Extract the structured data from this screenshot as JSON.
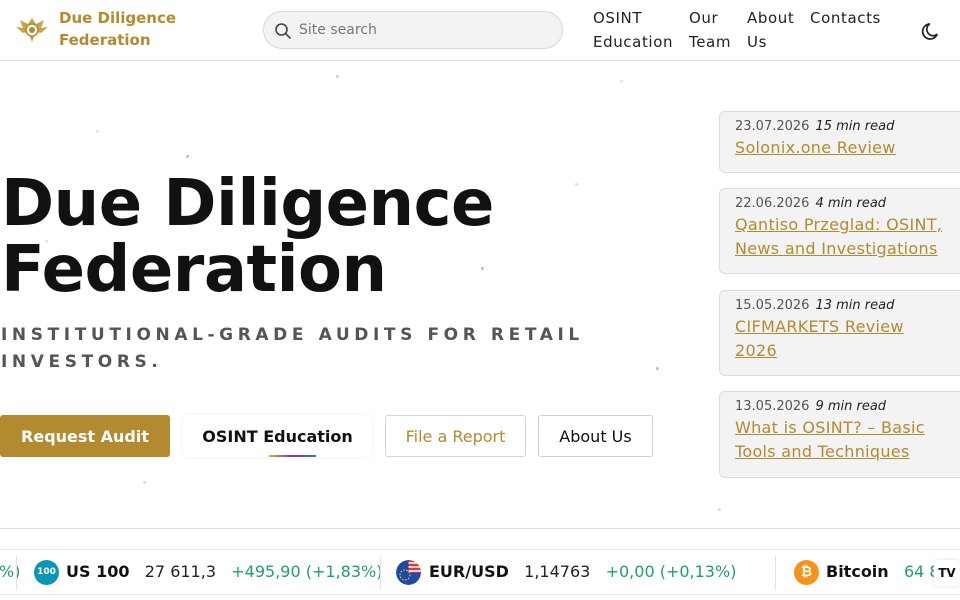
{
  "header": {
    "brand_line1": "Due Diligence",
    "brand_line2": "Federation",
    "search_placeholder": "Site search",
    "nav": [
      {
        "line1": "OSINT",
        "line2": "Education"
      },
      {
        "line1": "Our",
        "line2": "Team"
      },
      {
        "line1": "About",
        "line2": "Us"
      },
      {
        "line1": "Contacts",
        "line2": ""
      }
    ]
  },
  "hero": {
    "title_line1": "Due Diligence",
    "title_line2": "Federation",
    "subtitle_line1": "INSTITUTIONAL-GRADE AUDITS FOR RETAIL",
    "subtitle_line2": "INVESTORS.",
    "buttons": {
      "request_audit": "Request Audit",
      "osint_education": "OSINT Education",
      "file_report": "File a Report",
      "about_us": "About Us"
    }
  },
  "articles": [
    {
      "date": "23.07.2026",
      "read_time": "15 min read",
      "title": "Solonix.one Review"
    },
    {
      "date": "22.06.2026",
      "read_time": "4 min read",
      "title": "Qantiso Przeglad: OSINT, News and Investigations"
    },
    {
      "date": "15.05.2026",
      "read_time": "13 min read",
      "title": "CIFMARKETS Review 2026"
    },
    {
      "date": "13.05.2026",
      "read_time": "9 min read",
      "title": "What is OSINT? – Basic Tools and Techniques"
    }
  ],
  "ticker": {
    "leading_fragment": "%)",
    "items": [
      {
        "icon_text": "100",
        "symbol": "US 100",
        "price": "27 611,3",
        "change": "+495,90 (+1,83%)"
      },
      {
        "icon_text": "",
        "symbol": "EUR/USD",
        "price": "1,14763",
        "change": "+0,00 (+0,13%)"
      },
      {
        "icon_text": "₿",
        "symbol": "Bitcoin",
        "price": "64 8",
        "change": ""
      }
    ],
    "widget_logo": "TV"
  },
  "colors": {
    "accent": "#b48a30",
    "positive": "#1f9f6e"
  },
  "icons": {
    "logo": "eagle-emblem-icon",
    "search": "search-icon",
    "theme": "moon-icon",
    "us100": "nasdaq-100-icon",
    "eurusd": "eu-us-flag-icon",
    "bitcoin": "bitcoin-icon"
  }
}
